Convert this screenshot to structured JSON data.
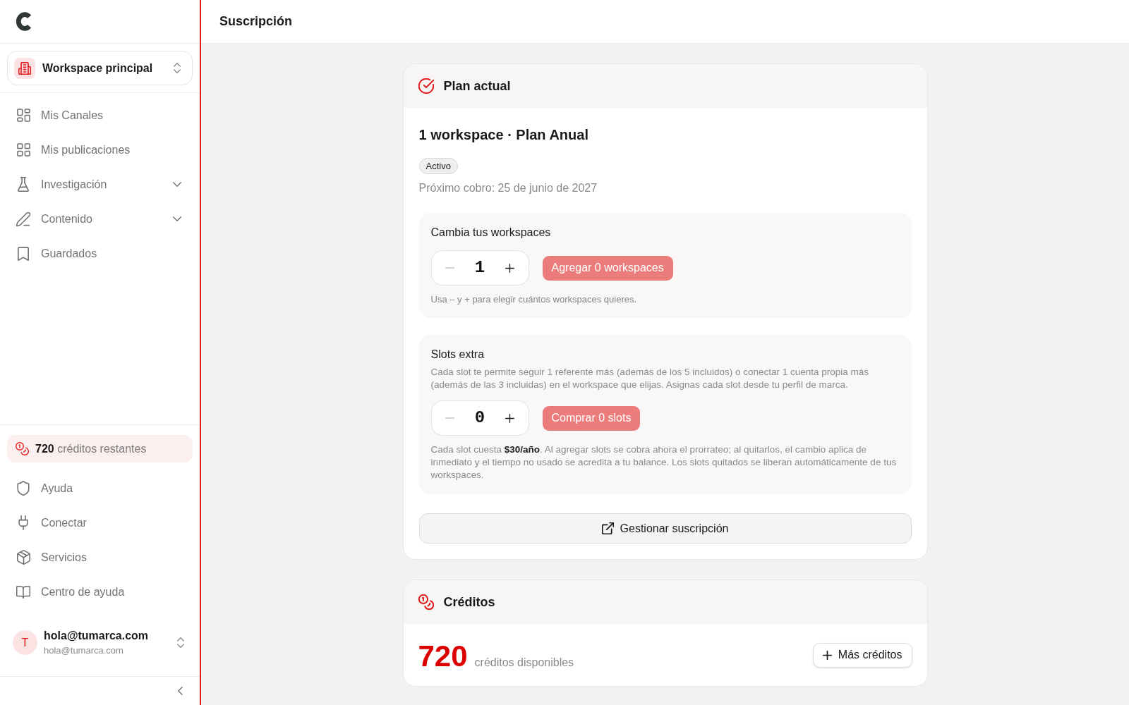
{
  "sidebar": {
    "workspace_selector": {
      "label": "Workspace principal"
    },
    "nav": [
      {
        "label": "Mis Canales",
        "kind": "link",
        "selected": false
      },
      {
        "label": "Mis publicaciones",
        "kind": "link",
        "selected": false
      },
      {
        "label": "Investigación",
        "kind": "group",
        "expanded": false,
        "selected": false
      },
      {
        "label": "Contenido",
        "kind": "group",
        "expanded": false,
        "selected": false
      },
      {
        "label": "Guardados",
        "kind": "link",
        "selected": false
      }
    ],
    "credits": {
      "text": "**720** créditos restantes"
    },
    "footer_nav": [
      {
        "label": "Ayuda",
        "selected": false
      },
      {
        "label": "Conectar",
        "selected": false
      },
      {
        "label": "Servicios",
        "selected": false
      },
      {
        "label": "Centro de ayuda",
        "selected": false
      }
    ],
    "user": {
      "avatar_initial": "T",
      "name": "hola@tumarca.com",
      "email": "hola@tumarca.com"
    }
  },
  "header": {
    "title": "Suscripción"
  },
  "plan_card": {
    "title": "Plan actual",
    "plan_name": "1 workspace · Plan Anual",
    "status_badge": "Activo",
    "next_charge": "Próximo cobro: 25 de junio de 2027",
    "workspaces": {
      "title": "Cambia tus workspaces",
      "stepper": {
        "value": "1",
        "decrement_disabled": true,
        "increment_disabled": false
      },
      "action": {
        "label": "Agregar 0 workspaces",
        "disabled": true
      },
      "hint": "Usa – y + para elegir cuántos workspaces quieres."
    },
    "slots": {
      "title": "Slots extra",
      "description": "Cada slot te permite seguir 1 referente más (además de los 5 incluidos) o conectar 1 cuenta propia más (además de las 3 incluidas) en el workspace que elijas. Asignas cada slot desde tu perfil de marca.",
      "stepper": {
        "value": "0",
        "decrement_disabled": true,
        "increment_disabled": false
      },
      "action": {
        "label": "Comprar 0 slots",
        "disabled": true
      },
      "note": "Cada slot cuesta **$30/año**. Al agregar slots se cobra ahora el prorrateo; al quitarlos, el cambio aplica de inmediato y el tiempo no usado se acredita a tu balance. Los slots quitados se liberan automáticamente de tus workspaces."
    },
    "manage_button": "Gestionar suscripción"
  },
  "credits_card": {
    "title": "Créditos",
    "amount": "720",
    "label": "créditos disponibles",
    "button": "Más créditos"
  }
}
